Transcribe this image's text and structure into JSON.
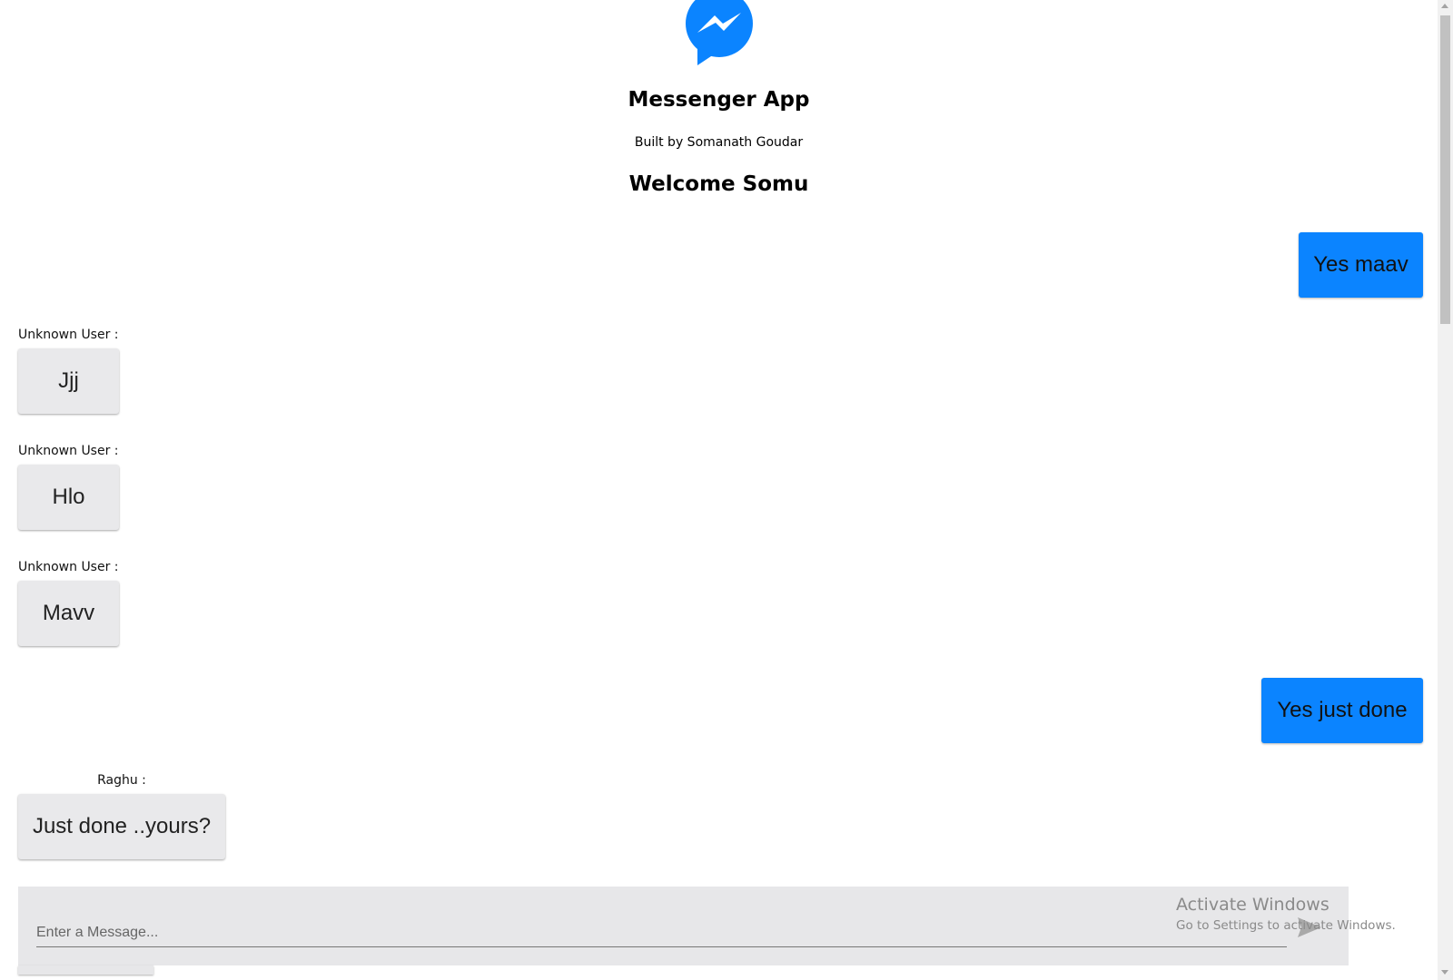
{
  "header": {
    "logo_icon": "messenger-icon",
    "title": "Messenger App",
    "subtitle": "Built by Somanath Goudar",
    "welcome": "Welcome Somu"
  },
  "colors": {
    "accent": "#0b84ff",
    "incoming_bubble": "#e9e9eb",
    "composer": "#e7e7e9"
  },
  "messages": [
    {
      "from": "self",
      "text": "Yes maav"
    },
    {
      "from": "other",
      "sender": "Unknown User :",
      "text": "Jjj"
    },
    {
      "from": "other",
      "sender": "Unknown User :",
      "text": "Hlo"
    },
    {
      "from": "other",
      "sender": "Unknown User :",
      "text": "Mavv"
    },
    {
      "from": "self",
      "text": "Yes just done"
    },
    {
      "from": "other",
      "sender": "Raghu :",
      "text": "Just done ..yours?"
    }
  ],
  "composer": {
    "placeholder": "Enter a Message...",
    "value": "",
    "send_icon": "send-icon"
  },
  "watermark": {
    "line1": "Activate Windows",
    "line2": "Go to Settings to activate Windows."
  }
}
